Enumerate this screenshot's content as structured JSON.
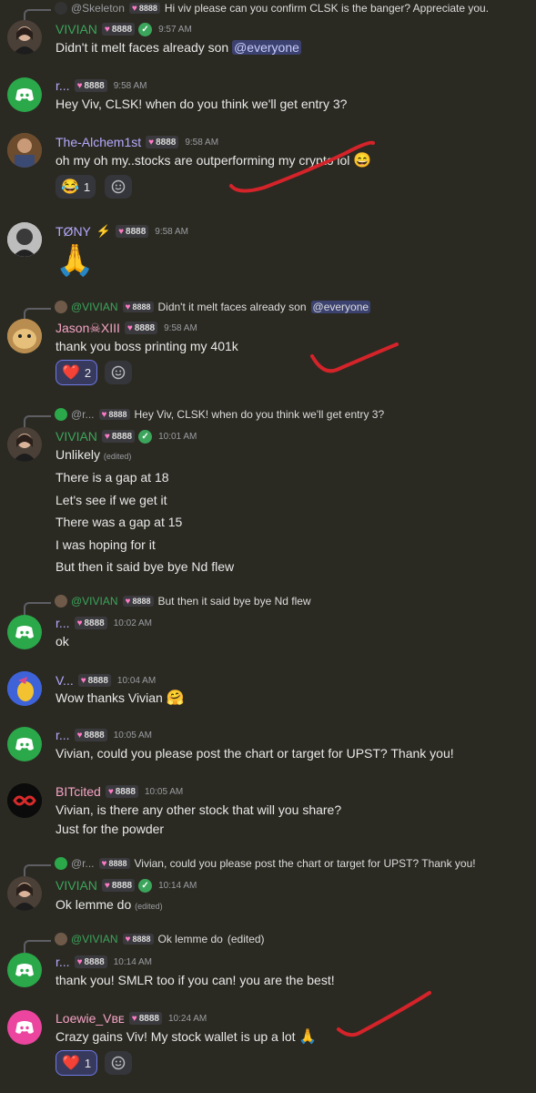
{
  "colors": {
    "background": "#2b2a22",
    "username_green": "#3ba55c",
    "badge_heart": "#ff7ac6",
    "annotation_red": "#d5232a"
  },
  "messages": [
    {
      "reply": {
        "author": "@Skeleton",
        "badge": "8888",
        "text": "Hi viv please can you confirm CLSK is the banger? Appreciate you."
      },
      "author": "VIVIAN",
      "badge": "8888",
      "time": "9:57 AM",
      "lines": [
        [
          "Didn't it melt faces already son ",
          "@everyone"
        ]
      ]
    },
    {
      "author": "r...",
      "badge": "8888",
      "time": "9:58 AM",
      "lines": [
        "Hey Viv, CLSK! when do you think we'll get entry 3?"
      ]
    },
    {
      "author": "The-Alchem1st",
      "badge": "8888",
      "time": "9:58 AM",
      "lines": [
        "oh my oh my..stocks are outperforming my crypto lol"
      ],
      "reaction": {
        "emoji": "😂",
        "count": "1"
      }
    },
    {
      "author": "TØNY",
      "badge": "8888",
      "time": "9:58 AM",
      "lines": [
        "🙏"
      ]
    },
    {
      "reply": {
        "author": "@VIVIAN",
        "badge": "8888",
        "text": "Didn't it melt faces already son",
        "mention": "@everyone"
      },
      "author": "Jason☠XIII",
      "badge": "8888",
      "time": "9:58 AM",
      "lines": [
        "thank you boss printing my 401k"
      ],
      "reaction": {
        "emoji": "❤️",
        "count": "2"
      }
    },
    {
      "reply": {
        "author": "@r...",
        "badge": "8888",
        "text": "Hey Viv, CLSK! when do you think we'll get entry 3?"
      },
      "author": "VIVIAN",
      "badge": "8888",
      "time": "10:01 AM",
      "lines": [
        "Unlikely",
        "There is a gap at 18",
        "Let's see if we get it",
        "There was a gap at 15",
        "I was hoping for it",
        "But then it said bye bye Nd flew"
      ],
      "edited": "(edited)"
    },
    {
      "reply": {
        "author": "@VIVIAN",
        "badge": "8888",
        "text": "But then it said bye bye Nd flew"
      },
      "author": "r...",
      "badge": "8888",
      "time": "10:02 AM",
      "lines": [
        "ok"
      ]
    },
    {
      "author": "V...",
      "badge": "8888",
      "time": "10:04 AM",
      "lines": [
        "Wow thanks Vivian"
      ]
    },
    {
      "author": "r...",
      "badge": "8888",
      "time": "10:05 AM",
      "lines": [
        "Vivian, could you please post the chart or target for UPST? Thank you!"
      ]
    },
    {
      "author": "BITcited",
      "badge": "8888",
      "time": "10:05 AM",
      "lines": [
        "Vivian, is there any other stock that will you share?",
        "Just for the powder"
      ]
    },
    {
      "reply": {
        "author": "@r...",
        "badge": "8888",
        "text": "Vivian, could you please post the chart or target for UPST? Thank you!"
      },
      "author": "VIVIAN",
      "badge": "8888",
      "time": "10:14 AM",
      "lines": [
        "Ok lemme do"
      ],
      "edited": "(edited)"
    },
    {
      "reply": {
        "author": "@VIVIAN",
        "badge": "8888",
        "text": "Ok lemme do",
        "edited": "(edited)"
      },
      "author": "r...",
      "badge": "8888",
      "time": "10:14 AM",
      "lines": [
        "thank you! SMLR too if you can! you are the best!"
      ]
    },
    {
      "author": "Loewie_Vʙᴇ",
      "badge": "8888",
      "time": "10:24 AM",
      "lines": [
        "Crazy gains Viv! My stock wallet is up a lot"
      ],
      "reaction": {
        "emoji": "❤️",
        "count": "1"
      }
    }
  ]
}
